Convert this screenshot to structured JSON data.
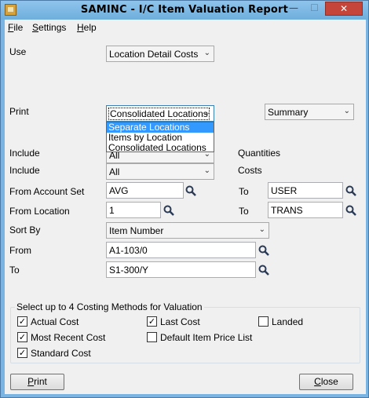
{
  "window": {
    "title": "SAMINC - I/C Item Valuation Report",
    "minimize_glyph": "—",
    "maximize_glyph": "☐",
    "close_glyph": "✕"
  },
  "menu": {
    "file": {
      "first": "F",
      "rest": "ile"
    },
    "settings": {
      "first": "S",
      "rest": "ettings"
    },
    "help": {
      "first": "H",
      "rest": "elp"
    }
  },
  "form": {
    "use_label": "Use",
    "use_value": "Location Detail Costs",
    "print_label": "Print",
    "print_value": "Consolidated Locations",
    "print_options": [
      "Separate Locations",
      "Items by Location",
      "Consolidated Locations"
    ],
    "print_selected_option": "Separate Locations",
    "summary_value": "Summary",
    "include_label_1": "Include",
    "include_value_1": "All",
    "quantities_label": "Quantities",
    "include_label_2": "Include",
    "include_value_2": "All",
    "costs_label": "Costs",
    "from_account_set_label": "From Account Set",
    "from_account_set_value": "AVG",
    "to_account_set_label": "To",
    "to_account_set_value": "USER",
    "from_location_label": "From Location",
    "from_location_value": "1",
    "to_location_label": "To",
    "to_location_value": "TRANS",
    "sort_by_label": "Sort By",
    "sort_by_value": "Item Number",
    "from_label": "From",
    "from_value": "A1-103/0",
    "to_label": "To",
    "to_value": "S1-300/Y"
  },
  "costing": {
    "title": "Select up to 4 Costing Methods for Valuation",
    "actual_cost": {
      "label": "Actual Cost",
      "checked": true
    },
    "last_cost": {
      "label": "Last Cost",
      "checked": true
    },
    "landed": {
      "label": "Landed",
      "checked": false
    },
    "most_recent_cost": {
      "label": "Most Recent Cost",
      "checked": true
    },
    "default_item_price_list": {
      "label": "Default Item Price List",
      "checked": false
    },
    "standard_cost": {
      "label": "Standard Cost",
      "checked": true
    }
  },
  "buttons": {
    "print": {
      "first": "P",
      "rest": "rint"
    },
    "close": {
      "first": "C",
      "rest": "lose"
    }
  },
  "glyphs": {
    "check": "✓",
    "combo_arrow": "⌄"
  },
  "colors": {
    "title_bar": "#79b4e2",
    "close_button": "#c6453a",
    "selection": "#3399ff"
  }
}
